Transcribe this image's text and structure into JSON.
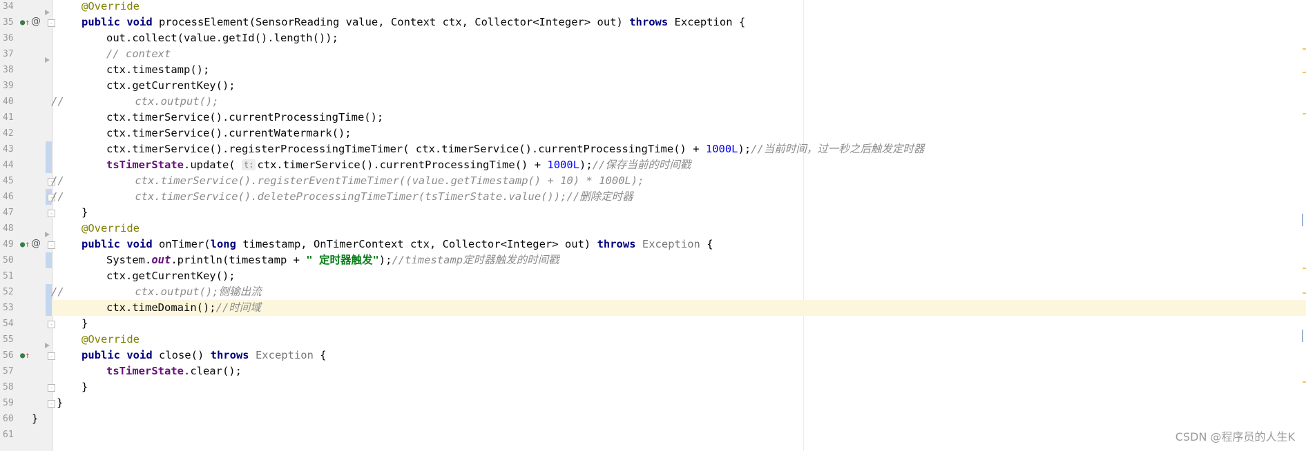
{
  "editor": {
    "lines": [
      {
        "n": "34",
        "parts": [
          {
            "c": "ann",
            "t": "@Override"
          }
        ],
        "indent": 2
      },
      {
        "n": "35",
        "parts": [
          {
            "c": "kw",
            "t": "public void "
          },
          {
            "c": "",
            "t": "processElement(SensorReading value, Context ctx, Collector<Integer> out) "
          },
          {
            "c": "kw",
            "t": "throws "
          },
          {
            "c": "",
            "t": "Exception {"
          }
        ],
        "indent": 2
      },
      {
        "n": "36",
        "parts": [
          {
            "c": "",
            "t": "out.collect(value.getId().length());"
          }
        ],
        "indent": 3
      },
      {
        "n": "37",
        "parts": [
          {
            "c": "cmt",
            "t": "// context"
          }
        ],
        "indent": 3
      },
      {
        "n": "38",
        "parts": [
          {
            "c": "",
            "t": "ctx.timestamp();"
          }
        ],
        "indent": 3
      },
      {
        "n": "39",
        "parts": [
          {
            "c": "",
            "t": "ctx.getCurrentKey();"
          }
        ],
        "indent": 3
      },
      {
        "n": "40",
        "parts": [
          {
            "c": "cmt",
            "t": "//           ctx.output();"
          }
        ],
        "indent": 0
      },
      {
        "n": "41",
        "parts": [
          {
            "c": "",
            "t": "ctx.timerService().currentProcessingTime();"
          }
        ],
        "indent": 3
      },
      {
        "n": "42",
        "parts": [
          {
            "c": "",
            "t": "ctx.timerService().currentWatermark();"
          }
        ],
        "indent": 3
      },
      {
        "n": "43",
        "parts": [
          {
            "c": "",
            "t": "ctx.timerService().registerProcessingTimeTimer( ctx.timerService().currentProcessingTime() + "
          },
          {
            "c": "num",
            "t": "1000L"
          },
          {
            "c": "",
            "t": ");"
          },
          {
            "c": "cmt",
            "t": "//当前时间，过一秒之后触发定时器"
          }
        ],
        "indent": 3
      },
      {
        "n": "44",
        "parts": [
          {
            "c": "field",
            "t": "tsTimerState"
          },
          {
            "c": "",
            "t": ".update( "
          },
          {
            "c": "hint",
            "t": "t:"
          },
          {
            "c": "",
            "t": "ctx.timerService().currentProcessingTime() + "
          },
          {
            "c": "num",
            "t": "1000L"
          },
          {
            "c": "",
            "t": ");"
          },
          {
            "c": "cmt",
            "t": "//保存当前的时间戳"
          }
        ],
        "indent": 3
      },
      {
        "n": "45",
        "parts": [
          {
            "c": "cmt",
            "t": "//           ctx.timerService().registerEventTimeTimer((value.getTimestamp() + 10) * 1000L);"
          }
        ],
        "indent": 0
      },
      {
        "n": "46",
        "parts": [
          {
            "c": "cmt",
            "t": "//           ctx.timerService().deleteProcessingTimeTimer(tsTimerState.value());//删除定时器"
          }
        ],
        "indent": 0
      },
      {
        "n": "47",
        "parts": [
          {
            "c": "",
            "t": "}"
          }
        ],
        "indent": 2
      },
      {
        "n": "48",
        "parts": [
          {
            "c": "ann",
            "t": "@Override"
          }
        ],
        "indent": 2
      },
      {
        "n": "49",
        "parts": [
          {
            "c": "kw",
            "t": "public void "
          },
          {
            "c": "",
            "t": "onTimer("
          },
          {
            "c": "kw",
            "t": "long "
          },
          {
            "c": "",
            "t": "timestamp, OnTimerContext ctx, Collector<Integer> out) "
          },
          {
            "c": "kw",
            "t": "throws "
          },
          {
            "c": "exc-gray",
            "t": "Exception"
          },
          {
            "c": "",
            "t": " {"
          }
        ],
        "indent": 2
      },
      {
        "n": "50",
        "parts": [
          {
            "c": "",
            "t": "System."
          },
          {
            "c": "static",
            "t": "out"
          },
          {
            "c": "",
            "t": ".println(timestamp + "
          },
          {
            "c": "str",
            "t": "\" 定时器触发\""
          },
          {
            "c": "",
            "t": ");"
          },
          {
            "c": "cmt",
            "t": "//timestamp定时器触发的时间戳"
          }
        ],
        "indent": 3
      },
      {
        "n": "51",
        "parts": [
          {
            "c": "",
            "t": "ctx.getCurrentKey();"
          }
        ],
        "indent": 3
      },
      {
        "n": "52",
        "parts": [
          {
            "c": "cmt",
            "t": "//           ctx.output();侧输出流"
          }
        ],
        "indent": 0
      },
      {
        "n": "53",
        "parts": [
          {
            "c": "",
            "t": "ctx.timeDomain();"
          },
          {
            "c": "cmt",
            "t": "//时间域"
          }
        ],
        "indent": 3
      },
      {
        "n": "54",
        "parts": [
          {
            "c": "",
            "t": "}"
          }
        ],
        "indent": 2
      },
      {
        "n": "55",
        "parts": [
          {
            "c": "ann",
            "t": "@Override"
          }
        ],
        "indent": 2
      },
      {
        "n": "56",
        "parts": [
          {
            "c": "kw",
            "t": "public void "
          },
          {
            "c": "",
            "t": "close() "
          },
          {
            "c": "kw",
            "t": "throws "
          },
          {
            "c": "exc-gray",
            "t": "Exception"
          },
          {
            "c": "",
            "t": " {"
          }
        ],
        "indent": 2
      },
      {
        "n": "57",
        "parts": [
          {
            "c": "field",
            "t": "tsTimerState"
          },
          {
            "c": "",
            "t": ".clear();"
          }
        ],
        "indent": 3
      },
      {
        "n": "58",
        "parts": [
          {
            "c": "",
            "t": "}"
          }
        ],
        "indent": 2
      },
      {
        "n": "59",
        "parts": [
          {
            "c": "",
            "t": "}"
          }
        ],
        "indent": 1
      },
      {
        "n": "60",
        "parts": [
          {
            "c": "",
            "t": "}"
          }
        ],
        "indent": 0
      },
      {
        "n": "61",
        "parts": [],
        "indent": 0
      }
    ],
    "current_line": "53"
  },
  "watermark": "CSDN @程序员的人生K",
  "icons": {
    "override_marker": "override-up-arrow-icon",
    "annotation_marker": "at-sign-icon"
  },
  "colors": {
    "keyword": "#000080",
    "annotation": "#808000",
    "comment": "#8c8c8c",
    "string": "#067d17",
    "number": "#0000ff",
    "current_line_bg": "#fcf6dc"
  }
}
